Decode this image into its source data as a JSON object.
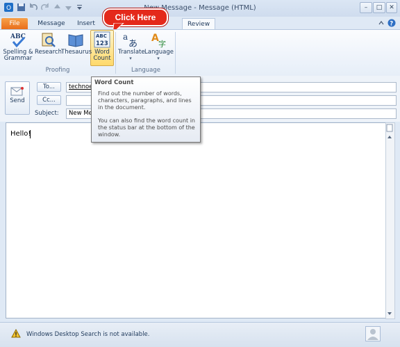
{
  "window": {
    "title": "New Message - Message (HTML)"
  },
  "callout": {
    "text": "Click Here"
  },
  "tabs": {
    "file": "File",
    "message": "Message",
    "insert": "Insert",
    "review": "Review"
  },
  "ribbon": {
    "spelling": "Spelling &",
    "grammar": "Grammar",
    "research": "Research",
    "thesaurus": "Thesaurus",
    "word": "Word",
    "count": "Count",
    "translate": "Translate",
    "language": "Language",
    "group_proofing": "Proofing",
    "group_language": "Language",
    "abc_text": "ABC",
    "abc123": "123"
  },
  "tooltip": {
    "title": "Word Count",
    "p1": "Find out the number of words, characters, paragraphs, and lines in the document.",
    "p2": "You can also find the word count in the status bar at the bottom of the window."
  },
  "header": {
    "send": "Send",
    "to_label": "To...",
    "cc_label": "Cc...",
    "subject_label": "Subject:",
    "to_value": "technoe",
    "subject_value": "New Mes"
  },
  "body": {
    "text": "Hello!"
  },
  "status": {
    "text": "Windows Desktop Search is not available."
  },
  "colors": {
    "file_tab": "#e96e1c",
    "callout": "#e4291b",
    "highlight": "#ffd96b"
  }
}
